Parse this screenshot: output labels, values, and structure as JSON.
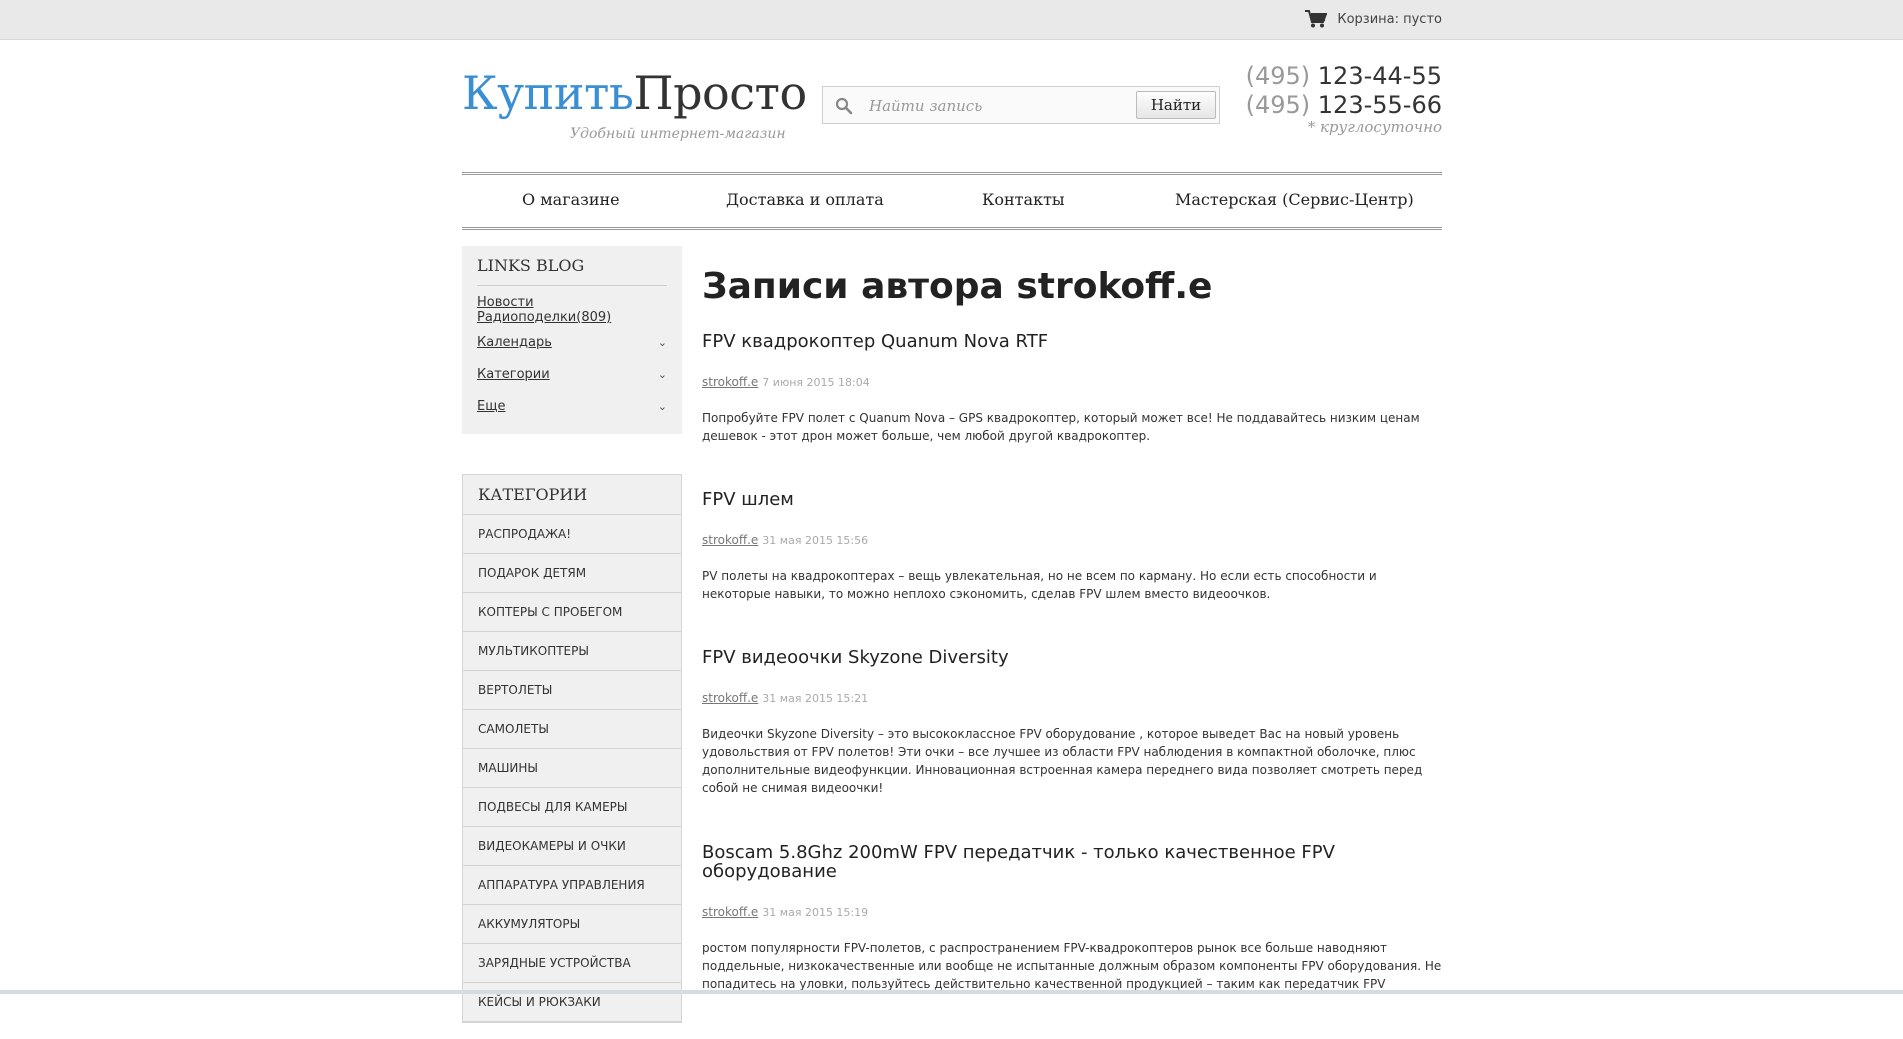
{
  "topbar": {
    "cart_label": "Корзина: пусто"
  },
  "header": {
    "logo_part1": "Купить",
    "logo_part2": "Просто",
    "tagline": "Удобный интернет-магазин",
    "search_placeholder": "Найти запись",
    "search_button": "Найти",
    "phones": [
      {
        "code": "(495)",
        "number": "123-44-55"
      },
      {
        "code": "(495)",
        "number": "123-55-66"
      }
    ],
    "hours": "* круглосуточно"
  },
  "nav": [
    "О магазине",
    "Доставка и оплата",
    "Контакты",
    "Мастерская (Сервис-Центр)"
  ],
  "sidebar": {
    "blog_title": "LINKS BLOG",
    "blog_items": [
      "Новости Радиоподелки(809)",
      "Календарь",
      "Категории",
      "Еще"
    ],
    "cats_title": "КАТЕГОРИИ",
    "categories": [
      "РАСПРОДАЖА!",
      "ПОДАРОК ДЕТЯМ",
      "КОПТЕРЫ С ПРОБЕГОМ",
      "МУЛЬТИКОПТЕРЫ",
      "ВЕРТОЛЕТЫ",
      "САМОЛЕТЫ",
      "МАШИНЫ",
      "ПОДВЕСЫ ДЛЯ КАМЕРЫ",
      "ВИДЕОКАМЕРЫ И ОЧКИ",
      "АППАРАТУРА УПРАВЛЕНИЯ",
      "АККУМУЛЯТОРЫ",
      "ЗАРЯДНЫЕ УСТРОЙСТВА",
      "КЕЙСЫ И РЮКЗАКИ"
    ]
  },
  "main": {
    "page_title": "Записи автора strokoff.e",
    "posts": [
      {
        "title": "FPV квадрокоптер Quanum Nova RTF",
        "author": "strokoff.e",
        "date": "7 июня 2015 18:04",
        "excerpt": "Попробуйте FPV полет с Quanum Nova – GPS квадрокоптер, который может все! Не поддавайтесь низким ценам дешевок - этот дрон может больше, чем любой другой квадрокоптер."
      },
      {
        "title": "FPV шлем",
        "author": "strokoff.e",
        "date": "31 мая 2015 15:56",
        "excerpt": "PV полеты на квадрокоптерах – вещь увлекательная, но не всем по карману. Но если есть способности и некоторые навыки, то можно неплохо сэкономить, сделав FPV шлем вместо видеоочков."
      },
      {
        "title": "FPV видеоочки Skyzone Diversity",
        "author": "strokoff.e",
        "date": "31 мая 2015 15:21",
        "excerpt": "Видеочки Skyzone Diversity – это высококлассное FPV оборудование , которое выведет Вас на новый уровень удовольствия от FPV полетов! Эти очки – все лучшее из области FPV наблюдения в компактной оболочке, плюс дополнительные видеофункции. Инновационная встроенная камера переднего вида позволяет смотреть перед собой не снимая видеоочки!"
      },
      {
        "title": "Boscam 5.8Ghz 200mW FPV передатчик - только качественное FPV оборудование",
        "author": "strokoff.e",
        "date": "31 мая 2015 15:19",
        "excerpt": "ростом популярности FPV-полетов, с распространением FPV-квадрокоптеров рынок все больше наводняют поддельные, низкокачественные или вообще не испытанные должным образом компоненты FPV оборудования. Не попадитесь на уловки, пользуйтесь действительно качественной продукцией – таким как передатчик FPV"
      }
    ]
  }
}
